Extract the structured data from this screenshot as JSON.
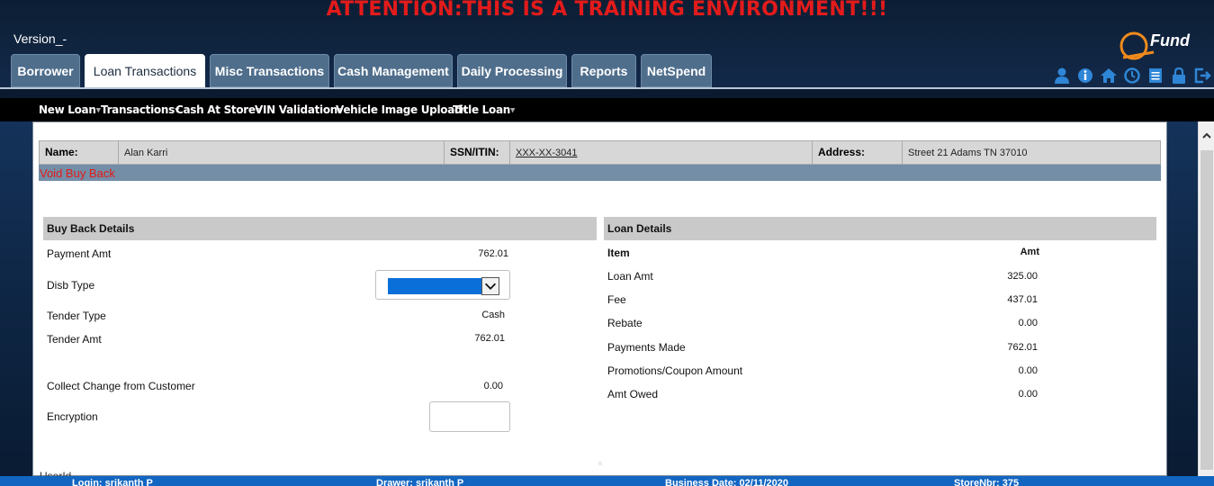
{
  "banner": "ATTENTION:THIS IS A TRAINING ENVIRONMENT!!!",
  "version": "Version_-",
  "logo_text": "Fund",
  "tabs": [
    {
      "label": "Borrower"
    },
    {
      "label": "Loan Transactions"
    },
    {
      "label": "Misc Transactions"
    },
    {
      "label": "Cash Management"
    },
    {
      "label": "Daily Processing"
    },
    {
      "label": "Reports"
    },
    {
      "label": "NetSpend"
    }
  ],
  "active_tab": "Loan Transactions",
  "header_icons": [
    "user-icon",
    "info-icon",
    "home-icon",
    "clock-icon",
    "document-icon",
    "lock-icon",
    "logout-icon"
  ],
  "subnav": [
    {
      "label": "New Loan",
      "dropdown": true
    },
    {
      "label": "Transactions",
      "dropdown": true
    },
    {
      "label": "Cash At Store",
      "dropdown": true
    },
    {
      "label": "VIN Validation",
      "dropdown": true
    },
    {
      "label": "Vehicle Image Upload",
      "dropdown": true
    },
    {
      "label": "Title Loan",
      "dropdown": true
    }
  ],
  "customer": {
    "name_label": "Name:",
    "name": "Alan Karri",
    "ssn_label": "SSN/ITIN:",
    "ssn": "XXX-XX-3041",
    "address_label": "Address:",
    "address": "Street 21  Adams  TN  37010"
  },
  "page_title": "Void Buy Back",
  "buy_back": {
    "heading": "Buy Back Details",
    "payment_amt_label": "Payment Amt",
    "payment_amt": "762.01",
    "disb_type_label": "Disb Type",
    "disb_type_value": "",
    "tender_type_label": "Tender Type",
    "tender_type": "Cash",
    "tender_amt_label": "Tender Amt",
    "tender_amt": "762.01",
    "collect_change_label": "Collect Change from Customer",
    "collect_change": "0.00",
    "encryption_label": "Encryption",
    "encryption_value": ""
  },
  "loan_details": {
    "heading": "Loan Details",
    "col_item": "Item",
    "col_amt": "Amt",
    "rows": [
      {
        "item": "Loan Amt",
        "amt": "325.00"
      },
      {
        "item": "Fee",
        "amt": "437.01"
      },
      {
        "item": "Rebate",
        "amt": "0.00"
      },
      {
        "item": "Payments Made",
        "amt": "762.01"
      },
      {
        "item": "Promotions/Coupon Amount",
        "amt": "0.00"
      },
      {
        "item": "Amt Owed",
        "amt": "0.00"
      }
    ]
  },
  "userid_label": "UserId",
  "footer": {
    "login": "Login: srikanth P",
    "drawer": "Drawer: srikanth P",
    "business_date": "Business Date: 02/11/2020",
    "store": "StoreNbr: 375"
  },
  "colors": {
    "banner_red": "#e31b1b",
    "tab_bg": "#4f6e8c",
    "footer_blue": "#1266c2",
    "strip": "#738ea6",
    "select_fill": "#0a6fd8"
  }
}
